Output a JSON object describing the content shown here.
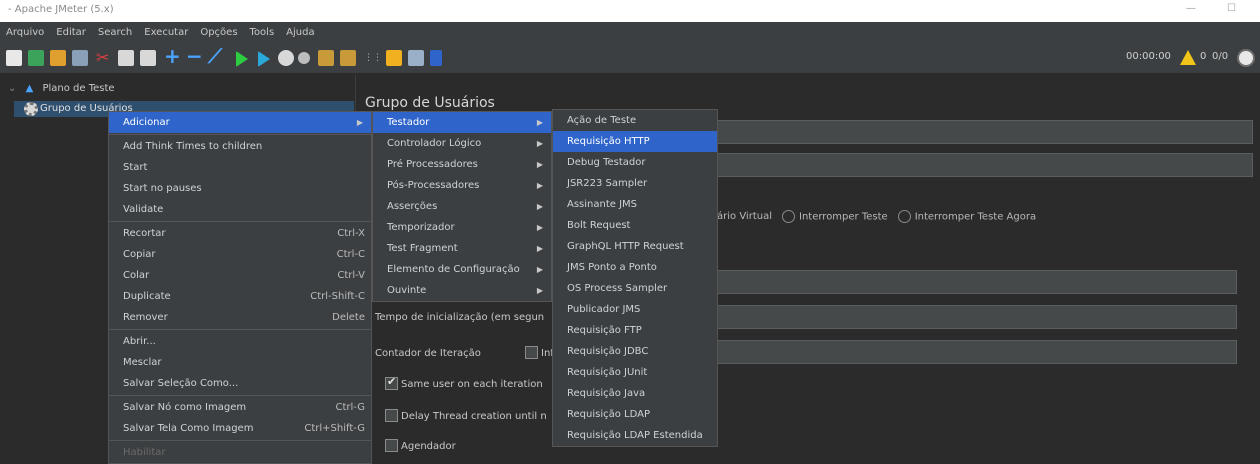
{
  "window": {
    "title": "- Apache JMeter (5.x)",
    "controls": "— ☐"
  },
  "menubar": [
    "Arquivo",
    "Editar",
    "Search",
    "Executar",
    "Opções",
    "Tools",
    "Ajuda"
  ],
  "toolbar": {
    "timer": "00:00:00",
    "warn_count": "0",
    "threads": "0/0"
  },
  "tree": {
    "root": "Plano de Teste",
    "selected": "Grupo de Usuários"
  },
  "panel": {
    "title": "Grupo de Usuários",
    "radios": [
      "ário Virtual",
      "Interromper Teste",
      "Interromper Teste Agora"
    ]
  },
  "context_menu": {
    "items": [
      {
        "label": "Adicionar",
        "shortcut": "",
        "arrow": true,
        "selected": true
      },
      {
        "sep": true
      },
      {
        "label": "Add Think Times to children"
      },
      {
        "label": "Start"
      },
      {
        "label": "Start no pauses"
      },
      {
        "label": "Validate"
      },
      {
        "sep": true
      },
      {
        "label": "Recortar",
        "shortcut": "Ctrl-X"
      },
      {
        "label": "Copiar",
        "shortcut": "Ctrl-C"
      },
      {
        "label": "Colar",
        "shortcut": "Ctrl-V"
      },
      {
        "label": "Duplicate",
        "shortcut": "Ctrl-Shift-C"
      },
      {
        "label": "Remover",
        "shortcut": "Delete"
      },
      {
        "sep": true
      },
      {
        "label": "Abrir..."
      },
      {
        "label": "Mesclar"
      },
      {
        "label": "Salvar Seleção Como..."
      },
      {
        "sep": true
      },
      {
        "label": "Salvar Nó como Imagem",
        "shortcut": "Ctrl-G"
      },
      {
        "label": "Salvar Tela Como Imagem",
        "shortcut": "Ctrl+Shift-G"
      },
      {
        "sep": true
      },
      {
        "label": "Habilitar",
        "disabled": true
      }
    ]
  },
  "submenu1": {
    "items": [
      {
        "label": "Testador",
        "selected": true
      },
      {
        "label": "Controlador Lógico"
      },
      {
        "label": "Pré Processadores"
      },
      {
        "label": "Pós-Processadores"
      },
      {
        "label": "Asserções"
      },
      {
        "label": "Temporizador"
      },
      {
        "label": "Test Fragment"
      },
      {
        "label": "Elemento de Configuração"
      },
      {
        "label": "Ouvinte"
      }
    ]
  },
  "submenu2": {
    "items": [
      {
        "label": "Ação de Teste"
      },
      {
        "label": "Requisição HTTP",
        "selected": true
      },
      {
        "label": "Debug Testador"
      },
      {
        "label": "JSR223 Sampler"
      },
      {
        "label": "Assinante JMS"
      },
      {
        "label": "Bolt Request"
      },
      {
        "label": "GraphQL HTTP Request"
      },
      {
        "label": "JMS Ponto a Ponto"
      },
      {
        "label": "OS Process Sampler"
      },
      {
        "label": "Publicador JMS"
      },
      {
        "label": "Requisição FTP"
      },
      {
        "label": "Requisição JDBC"
      },
      {
        "label": "Requisição JUnit"
      },
      {
        "label": "Requisição Java"
      },
      {
        "label": "Requisição LDAP"
      },
      {
        "label": "Requisição LDAP Estendida"
      }
    ]
  },
  "behind": {
    "tempo": "Tempo de inicialização (em segun",
    "contador": "Contador de Iteração",
    "inf": "Inf",
    "same_user": "Same user on each iteration",
    "delay": "Delay Thread creation until n",
    "agendador": "Agendador"
  }
}
